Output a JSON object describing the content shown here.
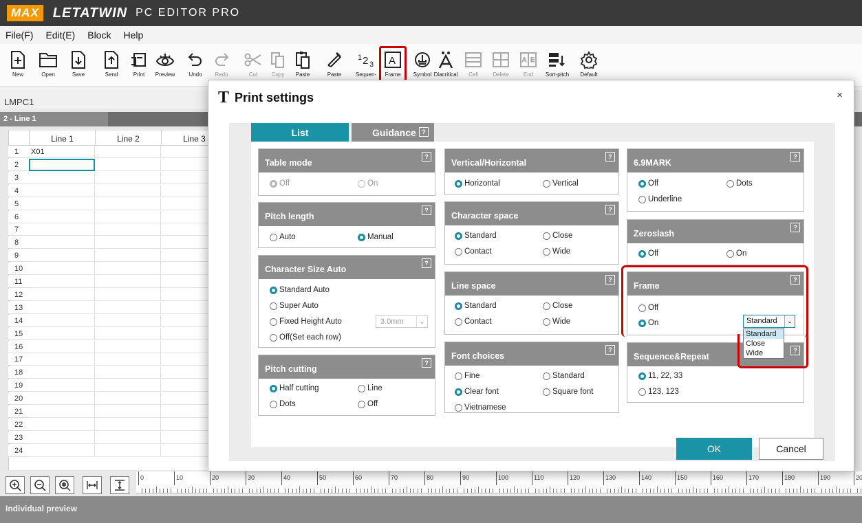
{
  "app": {
    "logo_max": "MAX",
    "logo_letatwin": "LETATWIN",
    "product": "PC EDITOR PRO"
  },
  "menu": [
    "File(F)",
    "Edit(E)",
    "Block",
    "Help"
  ],
  "toolbar": [
    {
      "label": "New",
      "icon": "new-file-icon",
      "disabled": false
    },
    {
      "label": "Open",
      "icon": "folder-open-icon",
      "disabled": false
    },
    {
      "label": "Save",
      "icon": "save-icon",
      "disabled": false
    },
    {
      "label": "Send",
      "icon": "send-icon",
      "disabled": false
    },
    {
      "label": "Print",
      "icon": "print-icon",
      "disabled": false
    },
    {
      "label": "Preview",
      "icon": "preview-icon",
      "disabled": false
    },
    {
      "label": "Undo",
      "icon": "undo-icon",
      "disabled": false
    },
    {
      "label": "Redo",
      "icon": "redo-icon",
      "disabled": true
    },
    {
      "label": "Cut",
      "icon": "scissors-icon",
      "disabled": true
    },
    {
      "label": "Copy",
      "icon": "copy-icon",
      "disabled": true
    },
    {
      "label": "Paste",
      "icon": "paste-icon",
      "disabled": false
    },
    {
      "label": "Paste",
      "icon": "paste-special-icon",
      "disabled": false
    },
    {
      "label": "Sequen-",
      "icon": "sequence-icon",
      "disabled": false
    },
    {
      "label": "Frame",
      "icon": "frame-icon",
      "disabled": false
    },
    {
      "label": "Symbol",
      "icon": "symbol-icon",
      "disabled": false
    },
    {
      "label": "Diacritical",
      "icon": "diacritical-icon",
      "disabled": false
    },
    {
      "label": "Cell",
      "icon": "cell-icon",
      "disabled": true
    },
    {
      "label": "Delete",
      "icon": "delete-icon",
      "disabled": true
    },
    {
      "label": "End",
      "icon": "end-icon",
      "disabled": true
    },
    {
      "label": "Sort-pitch",
      "icon": "sort-pitch-icon",
      "disabled": false
    },
    {
      "label": "Default",
      "icon": "gear-icon",
      "disabled": false
    }
  ],
  "file_name": "LMPC1",
  "line_tab": "2 - Line 1",
  "grid": {
    "columns": [
      "Line 1",
      "Line 2",
      "Line 3"
    ],
    "rows": [
      "1",
      "2",
      "3",
      "4",
      "5",
      "6",
      "7",
      "8",
      "9",
      "10",
      "11",
      "12",
      "13",
      "14",
      "15",
      "16",
      "17",
      "18",
      "19",
      "20",
      "21",
      "22",
      "23",
      "24"
    ],
    "cell_r1c1": "X01"
  },
  "ruler_ticks": [
    "0",
    "10",
    "20",
    "30",
    "40",
    "50",
    "60",
    "70",
    "80",
    "90",
    "100",
    "110",
    "120",
    "130",
    "140",
    "150",
    "160",
    "170",
    "180",
    "190",
    "20"
  ],
  "preview_label": "Individual preview",
  "dialog": {
    "title": "Print settings",
    "close": "×",
    "tabs": {
      "list": "List",
      "guidance": "Guidance"
    },
    "help": "?",
    "table_mode": {
      "title": "Table mode",
      "off": "Off",
      "on": "On"
    },
    "pitch_length": {
      "title": "Pitch length",
      "auto": "Auto",
      "manual": "Manual"
    },
    "char_size": {
      "title": "Character Size Auto",
      "standard": "Standard Auto",
      "super": "Super Auto",
      "fixed": "Fixed Height Auto",
      "fixed_value": "3.0mm",
      "off": "Off(Set each row)"
    },
    "pitch_cutting": {
      "title": "Pitch cutting",
      "half": "Half cutting",
      "line": "Line",
      "dots": "Dots",
      "off": "Off"
    },
    "vh": {
      "title": "Vertical/Horizontal",
      "horizontal": "Horizontal",
      "vertical": "Vertical"
    },
    "char_space": {
      "title": "Character space",
      "standard": "Standard",
      "close": "Close",
      "contact": "Contact",
      "wide": "Wide"
    },
    "line_space": {
      "title": "Line space",
      "standard": "Standard",
      "close": "Close",
      "contact": "Contact",
      "wide": "Wide"
    },
    "font": {
      "title": "Font choices",
      "fine": "Fine",
      "standard": "Standard",
      "clear": "Clear font",
      "square": "Square font",
      "vietnamese": "Vietnamese"
    },
    "mark69": {
      "title": "6.9MARK",
      "off": "Off",
      "dots": "Dots",
      "underline": "Underline"
    },
    "zeroslash": {
      "title": "Zeroslash",
      "off": "Off",
      "on": "On"
    },
    "frame": {
      "title": "Frame",
      "off": "Off",
      "on": "On",
      "selected": "Standard",
      "options": [
        "Standard",
        "Close",
        "Wide"
      ]
    },
    "seq": {
      "title": "Sequence&Repeat",
      "a": "11, 22, 33",
      "b": "123, 123"
    },
    "ok": "OK",
    "cancel": "Cancel"
  },
  "colors": {
    "accent": "#1a93a7",
    "header_gray": "#8d8d8d",
    "highlight_red": "#cc0000",
    "logo_orange": "#f39800"
  }
}
